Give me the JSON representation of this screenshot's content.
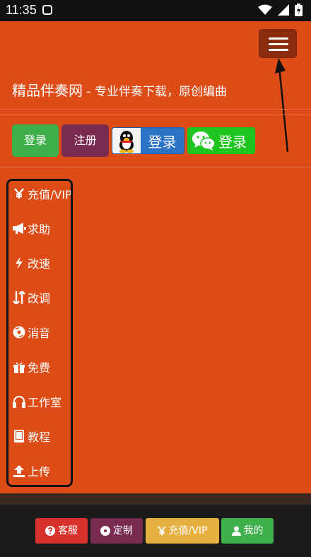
{
  "status_bar": {
    "time": "11:35"
  },
  "header": {
    "brand": "精品伴奏网",
    "tagline": " - 专业伴奏下载，原创编曲"
  },
  "auth": {
    "login_label": "登录",
    "register_label": "注册",
    "qq_login_label": "登录",
    "wechat_login_label": "登录"
  },
  "side_menu": {
    "items": [
      {
        "label": "充值/VIP",
        "icon": "yen-icon"
      },
      {
        "label": "求助",
        "icon": "bullhorn-icon"
      },
      {
        "label": "改速",
        "icon": "bolt-icon"
      },
      {
        "label": "改调",
        "icon": "sort-arrows-icon"
      },
      {
        "label": "消音",
        "icon": "disc-icon"
      },
      {
        "label": "免费",
        "icon": "gift-icon"
      },
      {
        "label": "工作室",
        "icon": "headphones-icon"
      },
      {
        "label": "教程",
        "icon": "book-icon"
      },
      {
        "label": "上传",
        "icon": "upload-icon"
      }
    ]
  },
  "footer": {
    "service_label": "客服",
    "custom_label": "定制",
    "vip_label": "充值/VIP",
    "mine_label": "我的"
  },
  "colors": {
    "page_bg": "#dd4b16",
    "menu_toggle": "#8b2c0f",
    "login_green": "#3db04a",
    "register_purple": "#7a2a4f",
    "qq_blue": "#2b73c5",
    "wechat_green": "#1fc51e",
    "service_red": "#d9312b",
    "vip_yellow": "#e8b040"
  }
}
